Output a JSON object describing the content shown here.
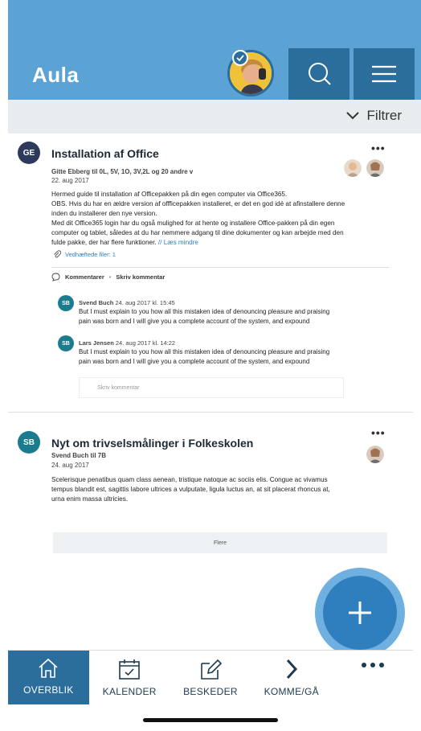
{
  "header": {
    "title": "Aula",
    "profile_avatar_icon": "profile-photo",
    "verified_icon": "check-icon",
    "search_icon": "search-icon",
    "menu_icon": "hamburger-icon"
  },
  "filter": {
    "label": "Filtrer",
    "icon": "chevron-down-icon"
  },
  "posts": [
    {
      "initials": "GE",
      "initials_color": "#2e3a5c",
      "title": "Installation af Office",
      "author_line": "Gitte Ebberg til 0L, 5V, 1O, 3V,2L og 20 andre v",
      "date": "22. aug 2017",
      "body_lines": [
        "Hermed guide til installation af Officepakken på din egen computer via Office365.",
        "OBS. Hvis du har en ældre version af offficepakken installeret, er det en god idé at afinstallere denne",
        "inden du installerer den nye version.",
        "Med dit Office365 login har du også mulighed for at hente og installere Office-pakken på din egen",
        "computer og tablet, således at du har nemmere adgang til dine dokumenter og kan arbejde med den",
        "fulde pakke, der har flere funktioner."
      ],
      "read_less": "// Læs mindre",
      "attachment": "Vedhæftede filer: 1",
      "comments_label": "Kommentarer",
      "write_comment_label": "Skriv kommentar",
      "comments": [
        {
          "initials": "SB",
          "author": "Svend Buch",
          "timestamp": "24. aug 2017   kl. 15:45",
          "lines": [
            "But I must explain to you how all this mistaken idea of denouncing pleasure and praising",
            "pain was born and I will give you a complete account of the system, and expound"
          ]
        },
        {
          "initials": "SB",
          "author": "Lars Jensen",
          "timestamp": "24. aug 2017   kl. 14:22",
          "lines": [
            "But I must explain to you how all this mistaken idea of denouncing pleasure and praising",
            "pain was born and I will give you a complete account of the system, and expound"
          ]
        }
      ],
      "comment_placeholder": "Skriv kommentar"
    },
    {
      "initials": "SB",
      "initials_color": "#1b7c8f",
      "title": "Nyt om trivselsmålinger i Folkeskolen",
      "author_line": "Svend Buch til 7B",
      "date": "24. aug 2017",
      "body_lines": [
        "Scelerisque penatibus quam class aenean, tristique natoque ac sociis elis. Congue ac vivamus",
        "tempus blandit est, sagittis labore ultrices a vulputate, ligula luctus an, at sit placerat rhoncus at,",
        "urna enim massa ultricies."
      ]
    }
  ],
  "more_button": "Flere",
  "fab_icon": "plus-icon",
  "bottom_nav": [
    {
      "label": "OVERBLIK",
      "icon": "home-icon",
      "active": true
    },
    {
      "label": "KALENDER",
      "icon": "calendar-icon",
      "active": false
    },
    {
      "label": "BESKEDER",
      "icon": "edit-icon",
      "active": false
    },
    {
      "label": "KOMME/GÅ",
      "icon": "chevron-right-icon",
      "active": false
    },
    {
      "label": "",
      "icon": "more-icon",
      "active": false
    }
  ],
  "colors": {
    "header": "#5aa3d4",
    "header_dark": "#2b6d9b",
    "fab": "#2f7fbe",
    "link": "#2a7fbf"
  }
}
